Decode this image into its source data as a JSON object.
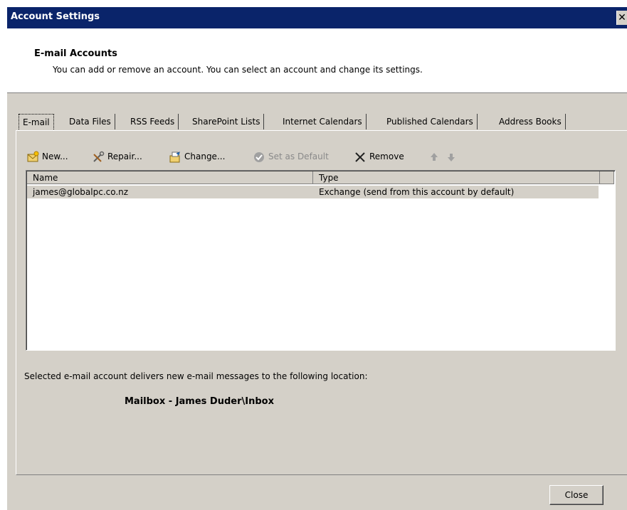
{
  "window": {
    "title": "Account Settings",
    "close_glyph": "✕"
  },
  "header": {
    "title": "E-mail Accounts",
    "subtitle": "You can add or remove an account. You can select an account and change its settings."
  },
  "tabs": [
    {
      "label": "E-mail",
      "active": true
    },
    {
      "label": "Data Files"
    },
    {
      "label": "RSS Feeds"
    },
    {
      "label": "SharePoint Lists"
    },
    {
      "label": "Internet Calendars"
    },
    {
      "label": "Published Calendars"
    },
    {
      "label": "Address Books"
    }
  ],
  "toolbar": {
    "new_label": "New...",
    "repair_label": "Repair...",
    "change_label": "Change...",
    "set_default_label": "Set as Default",
    "remove_label": "Remove",
    "icons": [
      "new-mail-icon",
      "repair-tools-icon",
      "change-folder-icon",
      "check-circle-icon",
      "x-remove-icon",
      "arrow-up-icon",
      "arrow-down-icon"
    ]
  },
  "accounts_table": {
    "columns": [
      "Name",
      "Type"
    ],
    "rows": [
      {
        "name": "james@globalpc.co.nz",
        "type": "Exchange (send from this account by default)",
        "selected": true
      }
    ]
  },
  "delivery": {
    "label": "Selected e-mail account delivers new e-mail messages to the following location:",
    "location": "Mailbox - James Duder\\Inbox"
  },
  "footer": {
    "close_label": "Close"
  },
  "colors": {
    "titlebar": "#0a246a",
    "dialog_bg": "#d4d0c8",
    "selection_bg": "#d4d0c8"
  }
}
